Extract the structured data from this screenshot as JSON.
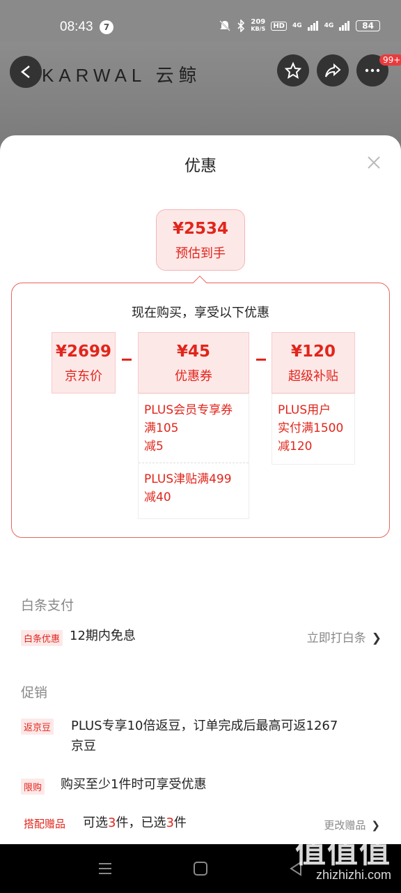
{
  "status": {
    "time": "08:43",
    "notif_count": "7",
    "speed_num": "209",
    "speed_unit": "KB/S",
    "hd": "HD",
    "net1": "4G",
    "net2": "4G",
    "battery": "84"
  },
  "header": {
    "brand": "KARWAL 云鲸",
    "badge": "99+"
  },
  "sheet": {
    "title": "优惠",
    "estimate_price": "¥2534",
    "estimate_label": "预估到手",
    "promo_heading": "现在购买，享受以下优惠",
    "cells": [
      {
        "value": "¥2699",
        "label": "京东价"
      },
      {
        "value": "¥45",
        "label": "优惠券"
      },
      {
        "value": "¥120",
        "label": "超级补贴"
      }
    ],
    "coupon_details": [
      "PLUS会员专享券",
      "满105",
      "减5"
    ],
    "coupon_details2": [
      "PLUS津贴满499",
      "减40"
    ],
    "subsidy_details": [
      "PLUS用户",
      "实付满1500",
      "减120"
    ]
  },
  "baitiao": {
    "section_title": "白条支付",
    "tag": "白条优惠",
    "text": "12期内免息",
    "action": "立即打白条"
  },
  "promotions": {
    "section_title": "促销",
    "items": [
      {
        "tag": "返京豆",
        "text_line1": "PLUS专享10倍返豆，订单完成后最高可返1267",
        "text_line2": "京豆"
      },
      {
        "tag": "限购",
        "text": "购买至少1件时可享受优惠"
      }
    ],
    "gift": {
      "tag": "搭配赠品",
      "prefix": "可选",
      "count1": "3",
      "mid": "件，已选",
      "count2": "3",
      "suffix": "件",
      "action": "更改赠品"
    }
  },
  "watermark": {
    "big": "值值值",
    "small": "zhizhizhi.com"
  },
  "colors": {
    "accent": "#e1251b",
    "accent_bg": "#fde8e8"
  }
}
